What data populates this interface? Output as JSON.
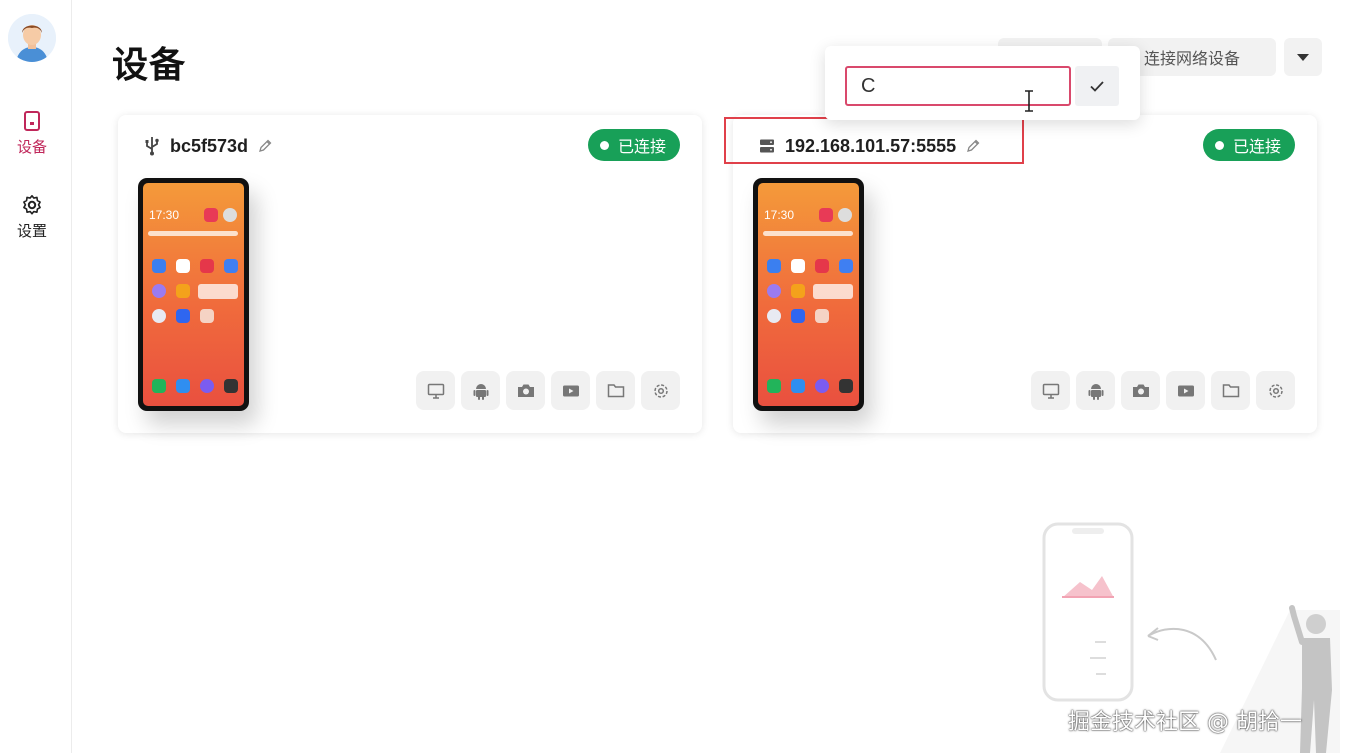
{
  "sidebar": {
    "items": [
      {
        "label": "设备",
        "active": true
      },
      {
        "label": "设置",
        "active": false
      }
    ]
  },
  "page": {
    "title": "设备"
  },
  "toolbar": {
    "connect_label": "连接网络设备"
  },
  "popover": {
    "input_value": "C"
  },
  "devices": [
    {
      "name": "bc5f573d",
      "connection": "usb-icon",
      "status": "已连接",
      "time": "17:30"
    },
    {
      "name": "192.168.101.57:5555",
      "connection": "server-icon",
      "status": "已连接",
      "time": "17:30"
    }
  ],
  "watermark": "掘金技术社区 @ 胡拾一",
  "colors": {
    "accent": "#c0275a",
    "status": "#18a058",
    "highlight": "#e0404a",
    "input_border": "#d9496c"
  }
}
